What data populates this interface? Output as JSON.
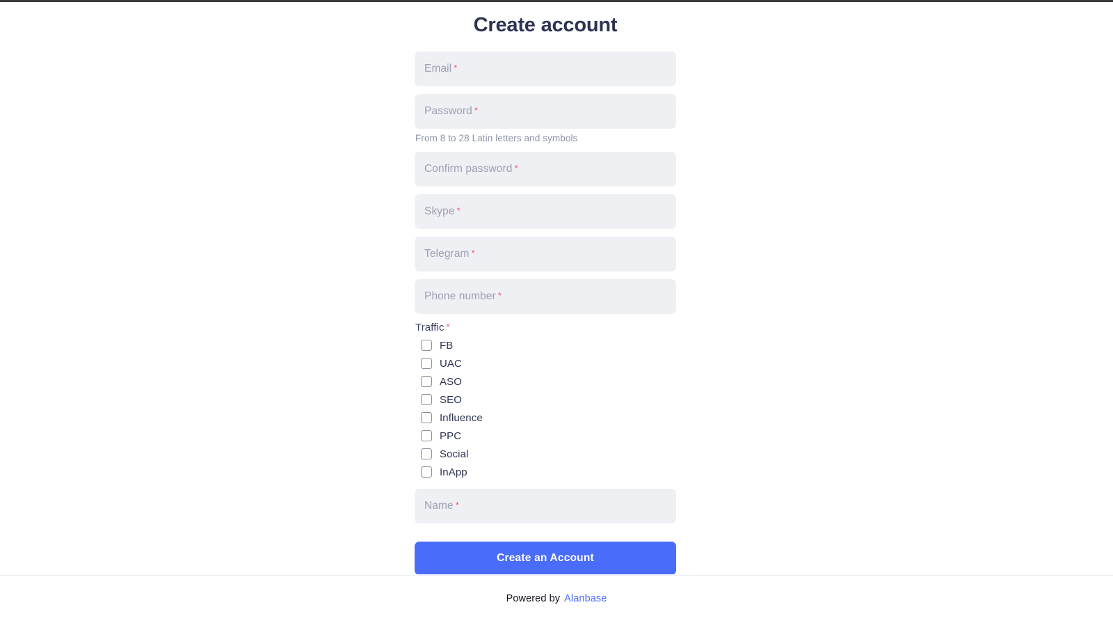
{
  "page": {
    "title": "Create account",
    "required_marker": "*"
  },
  "colors": {
    "accent": "#4a6cfa",
    "required": "#f4546e",
    "field_bg": "#eff0f4",
    "title_text": "#2d3352",
    "placeholder_text": "#9ba0b5",
    "helper_text": "#8d93a8"
  },
  "form": {
    "fields": [
      {
        "name": "email",
        "placeholder": "Email",
        "value": "",
        "required": true,
        "helper": ""
      },
      {
        "name": "password",
        "placeholder": "Password",
        "value": "",
        "required": true,
        "helper": "From 8 to 28 Latin letters and symbols"
      },
      {
        "name": "confirm-password",
        "placeholder": "Confirm password",
        "value": "",
        "required": true,
        "helper": ""
      },
      {
        "name": "skype",
        "placeholder": "Skype",
        "value": "",
        "required": true,
        "helper": ""
      },
      {
        "name": "telegram",
        "placeholder": "Telegram",
        "value": "",
        "required": true,
        "helper": ""
      },
      {
        "name": "phone-number",
        "placeholder": "Phone number",
        "value": "",
        "required": true,
        "helper": ""
      }
    ],
    "traffic": {
      "label": "Traffic",
      "required": true,
      "options": [
        {
          "label": "FB",
          "checked": false
        },
        {
          "label": "UAC",
          "checked": false
        },
        {
          "label": "ASO",
          "checked": false
        },
        {
          "label": "SEO",
          "checked": false
        },
        {
          "label": "Influence",
          "checked": false
        },
        {
          "label": "PPC",
          "checked": false
        },
        {
          "label": "Social",
          "checked": false
        },
        {
          "label": "InApp",
          "checked": false
        }
      ]
    },
    "name_field": {
      "name": "name",
      "placeholder": "Name",
      "value": "",
      "required": true
    },
    "submit_label": "Create an Account"
  },
  "footer": {
    "prefix": "Powered by",
    "brand": "Alanbase"
  }
}
